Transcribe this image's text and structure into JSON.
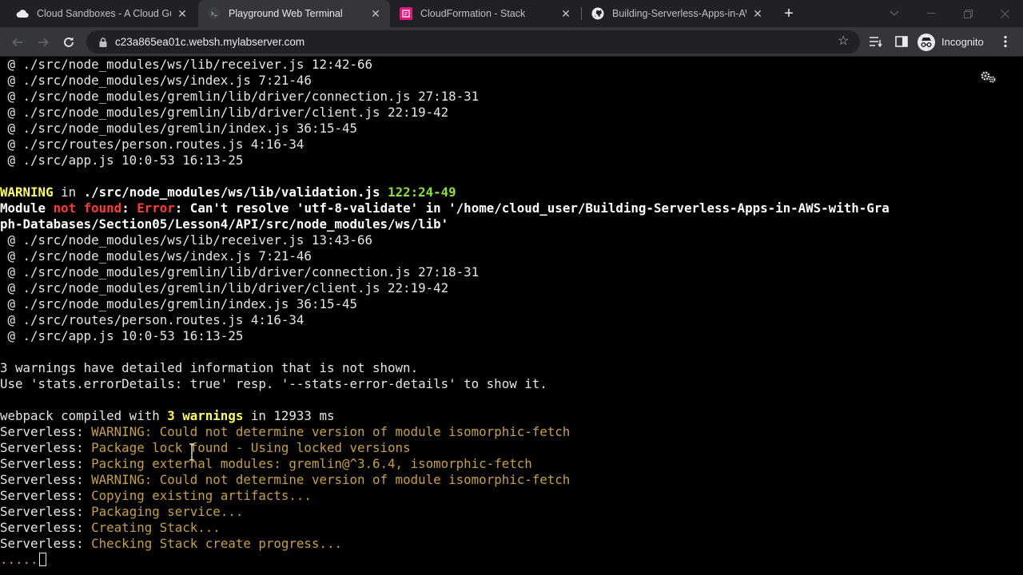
{
  "tabs": [
    {
      "title": "Cloud Sandboxes - A Cloud Guru",
      "favicon": "cloud-icon"
    },
    {
      "title": "Playground Web Terminal",
      "favicon": "terminal-icon"
    },
    {
      "title": "CloudFormation - Stack",
      "favicon": "cloudformation-icon"
    },
    {
      "title": "Building-Serverless-Apps-in-AWS",
      "favicon": "github-icon"
    }
  ],
  "toolbar": {
    "url": "c23a865ea01c.websh.mylabserver.com",
    "profile_label": "Incognito"
  },
  "terminal": {
    "lines": [
      {
        "spans": [
          {
            "t": " @ ./src/node_modules/ws/lib/receiver.js 12:42-66",
            "c": ""
          }
        ]
      },
      {
        "spans": [
          {
            "t": " @ ./src/node_modules/ws/index.js 7:21-46",
            "c": ""
          }
        ]
      },
      {
        "spans": [
          {
            "t": " @ ./src/node_modules/gremlin/lib/driver/connection.js 27:18-31",
            "c": ""
          }
        ]
      },
      {
        "spans": [
          {
            "t": " @ ./src/node_modules/gremlin/lib/driver/client.js 22:19-42",
            "c": ""
          }
        ]
      },
      {
        "spans": [
          {
            "t": " @ ./src/node_modules/gremlin/index.js 36:15-45",
            "c": ""
          }
        ]
      },
      {
        "spans": [
          {
            "t": " @ ./src/routes/person.routes.js 4:16-34",
            "c": ""
          }
        ]
      },
      {
        "spans": [
          {
            "t": " @ ./src/app.js 10:0-53 16:13-25",
            "c": ""
          }
        ]
      },
      {
        "spans": []
      },
      {
        "spans": [
          {
            "t": "WARNING",
            "c": "yel"
          },
          {
            "t": " in ",
            "c": ""
          },
          {
            "t": "./src/node_modules/ws/lib/validation.js",
            "c": "wht"
          },
          {
            "t": " ",
            "c": ""
          },
          {
            "t": "122:24-49",
            "c": "grn"
          }
        ]
      },
      {
        "spans": [
          {
            "t": "Module ",
            "c": "wht"
          },
          {
            "t": "not found",
            "c": "red"
          },
          {
            "t": ": ",
            "c": "wht"
          },
          {
            "t": "Error",
            "c": "red"
          },
          {
            "t": ": Can't resolve 'utf-8-validate' in '/home/cloud_user/Building-Serverless-Apps-in-AWS-with-Gra",
            "c": "wht"
          }
        ]
      },
      {
        "spans": [
          {
            "t": "ph-Databases/Section05/Lesson4/API/src/node_modules/ws/lib'",
            "c": "wht"
          }
        ]
      },
      {
        "spans": [
          {
            "t": " @ ./src/node_modules/ws/lib/receiver.js 13:43-66",
            "c": ""
          }
        ]
      },
      {
        "spans": [
          {
            "t": " @ ./src/node_modules/ws/index.js 7:21-46",
            "c": ""
          }
        ]
      },
      {
        "spans": [
          {
            "t": " @ ./src/node_modules/gremlin/lib/driver/connection.js 27:18-31",
            "c": ""
          }
        ]
      },
      {
        "spans": [
          {
            "t": " @ ./src/node_modules/gremlin/lib/driver/client.js 22:19-42",
            "c": ""
          }
        ]
      },
      {
        "spans": [
          {
            "t": " @ ./src/node_modules/gremlin/index.js 36:15-45",
            "c": ""
          }
        ]
      },
      {
        "spans": [
          {
            "t": " @ ./src/routes/person.routes.js 4:16-34",
            "c": ""
          }
        ]
      },
      {
        "spans": [
          {
            "t": " @ ./src/app.js 10:0-53 16:13-25",
            "c": ""
          }
        ]
      },
      {
        "spans": []
      },
      {
        "spans": [
          {
            "t": "3 warnings have detailed information that is not shown.",
            "c": ""
          }
        ]
      },
      {
        "spans": [
          {
            "t": "Use 'stats.errorDetails: true' resp. '--stats-error-details' to show it.",
            "c": ""
          }
        ]
      },
      {
        "spans": []
      },
      {
        "spans": [
          {
            "t": "webpack compiled with ",
            "c": ""
          },
          {
            "t": "3 warnings",
            "c": "yel"
          },
          {
            "t": " in 12933 ms",
            "c": ""
          }
        ]
      },
      {
        "spans": [
          {
            "t": "Serverless: ",
            "c": ""
          },
          {
            "t": "WARNING: Could not determine version of module isomorphic-fetch",
            "c": "org"
          }
        ]
      },
      {
        "spans": [
          {
            "t": "Serverless: ",
            "c": ""
          },
          {
            "t": "Package lock found - Using locked versions",
            "c": "org"
          }
        ]
      },
      {
        "spans": [
          {
            "t": "Serverless: ",
            "c": ""
          },
          {
            "t": "Packing external modules: gremlin@^3.6.4, isomorphic-fetch",
            "c": "org"
          }
        ]
      },
      {
        "spans": [
          {
            "t": "Serverless: ",
            "c": ""
          },
          {
            "t": "WARNING: Could not determine version of module isomorphic-fetch",
            "c": "org"
          }
        ]
      },
      {
        "spans": [
          {
            "t": "Serverless: ",
            "c": ""
          },
          {
            "t": "Copying existing artifacts...",
            "c": "org"
          }
        ]
      },
      {
        "spans": [
          {
            "t": "Serverless: ",
            "c": ""
          },
          {
            "t": "Packaging service...",
            "c": "org"
          }
        ]
      },
      {
        "spans": [
          {
            "t": "Serverless: ",
            "c": ""
          },
          {
            "t": "Creating Stack...",
            "c": "org"
          }
        ]
      },
      {
        "spans": [
          {
            "t": "Serverless: ",
            "c": ""
          },
          {
            "t": "Checking Stack create progress...",
            "c": "org"
          }
        ]
      },
      {
        "spans": [
          {
            "t": ".....",
            "c": "org"
          }
        ],
        "cursor": true
      }
    ]
  },
  "colors": {
    "tabstrip": "#202124",
    "toolbar": "#35363a",
    "terminal_bg": "#000000",
    "warning_yellow": "#ffff55",
    "error_red": "#ff3838",
    "location_green": "#8ae234",
    "serverless_orange": "#c8a03c"
  }
}
